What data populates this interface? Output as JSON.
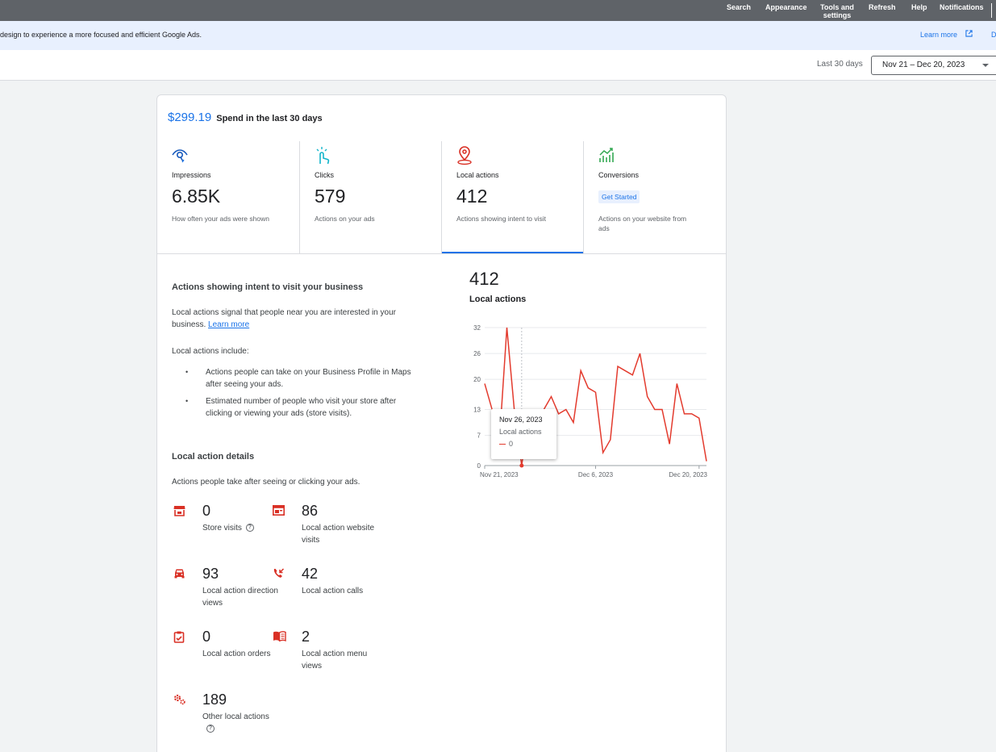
{
  "topnav": [
    {
      "label": "Search"
    },
    {
      "label": "Appearance"
    },
    {
      "label": "Tools and settings"
    },
    {
      "label": "Refresh"
    },
    {
      "label": "Help"
    },
    {
      "label": "Notifications"
    }
  ],
  "banner": {
    "message": "design to experience a more focused and efficient Google Ads.",
    "learn_more": "Learn more",
    "truncated": "D"
  },
  "datebar": {
    "label": "Last 30 days",
    "range": "Nov 21 – Dec 20, 2023"
  },
  "spend": {
    "amount": "$299.19",
    "text": "Spend in the last 30 days"
  },
  "tiles": [
    {
      "icon": "eye-icon",
      "name": "Impressions",
      "value": "6.85K",
      "desc": "How often your ads were shown"
    },
    {
      "icon": "pointer-icon",
      "name": "Clicks",
      "value": "579",
      "desc": "Actions on your ads"
    },
    {
      "icon": "map-pin-icon",
      "name": "Local actions",
      "value": "412",
      "desc": "Actions showing intent to visit"
    },
    {
      "icon": "trending-up-icon",
      "name": "Conversions",
      "button": "Get Started",
      "desc": "Actions on your website from ads"
    }
  ],
  "info": {
    "heading": "Actions showing intent to visit your business",
    "p1": "Local actions signal that people near you are interested in your business.",
    "learn_more": "Learn more",
    "includes": "Local actions include:",
    "bullets": [
      "Actions people can take on your Business Profile in Maps after seeing your ads.",
      "Estimated number of people who visit your store after clicking or viewing your ads (store visits)."
    ],
    "details_heading": "Local action details",
    "details_desc": "Actions people take after seeing or clicking your ads."
  },
  "details": [
    {
      "icon": "store-icon",
      "value": "0",
      "label": "Store visits",
      "help": "?"
    },
    {
      "icon": "web-icon",
      "value": "86",
      "label": "Local action website visits"
    },
    {
      "icon": "car-icon",
      "value": "93",
      "label": "Local action direction views"
    },
    {
      "icon": "phone-callback-icon",
      "value": "42",
      "label": "Local action calls"
    },
    {
      "icon": "clipboard-check-icon",
      "value": "0",
      "label": "Local action orders"
    },
    {
      "icon": "menu-book-icon",
      "value": "2",
      "label": "Local action menu views"
    },
    {
      "icon": "gears-icon",
      "value": "189",
      "label": "Other local actions",
      "help": "?"
    }
  ],
  "chart": {
    "total": "412",
    "title": "Local actions",
    "tooltip": {
      "date": "Nov 26, 2023",
      "series": "Local actions",
      "value": "0"
    }
  },
  "colors": {
    "accent": "#1a73e8",
    "line": "#e33b2e",
    "icon_red": "#d93025"
  },
  "chart_data": {
    "type": "line",
    "title": "Local actions",
    "x": [
      "Nov 21, 2023",
      "Nov 22, 2023",
      "Nov 23, 2023",
      "Nov 24, 2023",
      "Nov 25, 2023",
      "Nov 26, 2023",
      "Nov 27, 2023",
      "Nov 28, 2023",
      "Nov 29, 2023",
      "Nov 30, 2023",
      "Dec 1, 2023",
      "Dec 2, 2023",
      "Dec 3, 2023",
      "Dec 4, 2023",
      "Dec 5, 2023",
      "Dec 6, 2023",
      "Dec 7, 2023",
      "Dec 8, 2023",
      "Dec 9, 2023",
      "Dec 10, 2023",
      "Dec 11, 2023",
      "Dec 12, 2023",
      "Dec 13, 2023",
      "Dec 14, 2023",
      "Dec 15, 2023",
      "Dec 16, 2023",
      "Dec 17, 2023",
      "Dec 18, 2023",
      "Dec 19, 2023",
      "Dec 20, 2023"
    ],
    "xticks": [
      "Nov 21, 2023",
      "Dec 6, 2023",
      "Dec 20, 2023"
    ],
    "series": [
      {
        "values": [
          19,
          13,
          6,
          32,
          13,
          0,
          12,
          12,
          13,
          16,
          12,
          13,
          10,
          22,
          18,
          17,
          3,
          6,
          23,
          22,
          21,
          26,
          16,
          13,
          13,
          5,
          19,
          12,
          12,
          11,
          1
        ]
      }
    ],
    "yticks": [
      0,
      7,
      13,
      20,
      26,
      32
    ],
    "ylim": [
      0,
      32
    ],
    "xlabel": "",
    "ylabel": "",
    "grid": true,
    "legend": "none"
  }
}
